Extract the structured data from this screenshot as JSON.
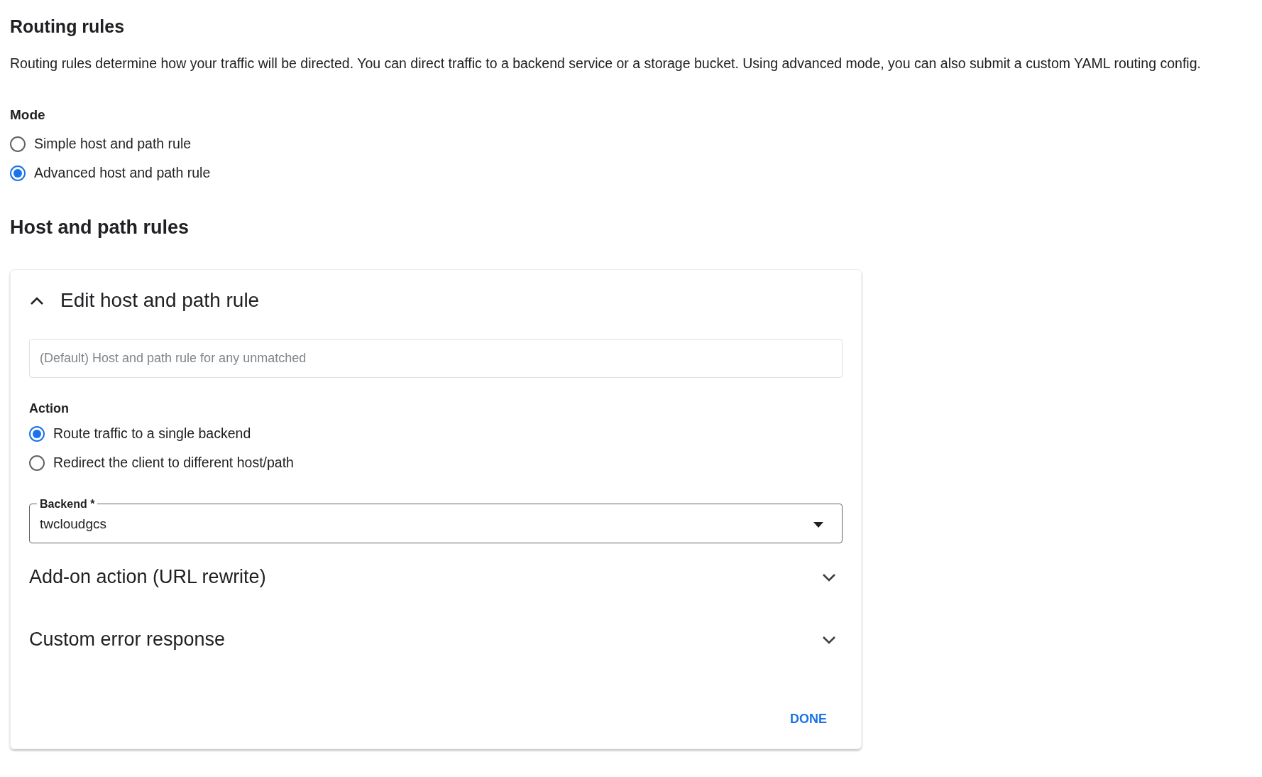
{
  "title": "Routing rules",
  "description": "Routing rules determine how your traffic will be directed. You can direct traffic to a backend service or a storage bucket. Using advanced mode, you can also submit a custom YAML routing config.",
  "mode": {
    "label": "Mode",
    "options": [
      {
        "label": "Simple host and path rule",
        "selected": false
      },
      {
        "label": "Advanced host and path rule",
        "selected": true
      }
    ]
  },
  "section_title": "Host and path rules",
  "rule_card": {
    "title": "Edit host and path rule",
    "expanded": true,
    "description_field": {
      "placeholder": "(Default) Host and path rule for any unmatched"
    },
    "action": {
      "label": "Action",
      "options": [
        {
          "label": "Route traffic to a single backend",
          "selected": true
        },
        {
          "label": "Redirect the client to different host/path",
          "selected": false
        }
      ]
    },
    "backend": {
      "label": "Backend *",
      "value": "twcloudgcs"
    },
    "sections": [
      {
        "title": "Add-on action (URL rewrite)",
        "expanded": false
      },
      {
        "title": "Custom error response",
        "expanded": false
      }
    ],
    "done_button": "DONE"
  }
}
